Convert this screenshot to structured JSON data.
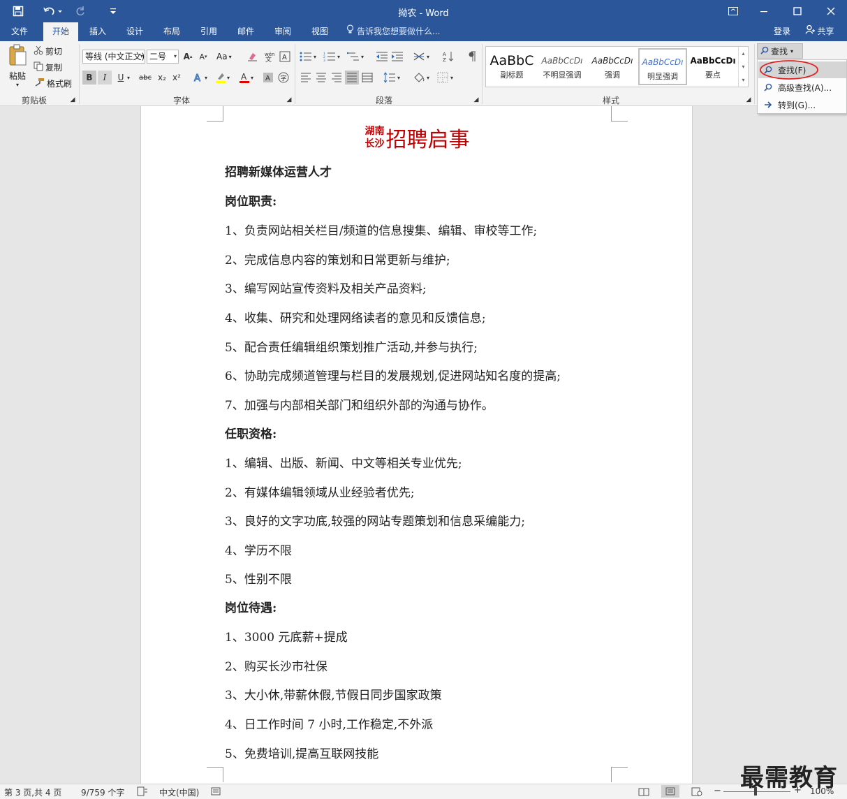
{
  "titlebar": {
    "title": "拗农 - Word"
  },
  "tabs": [
    {
      "label": "文件",
      "active": false
    },
    {
      "label": "开始",
      "active": true
    },
    {
      "label": "插入",
      "active": false
    },
    {
      "label": "设计",
      "active": false
    },
    {
      "label": "布局",
      "active": false
    },
    {
      "label": "引用",
      "active": false
    },
    {
      "label": "邮件",
      "active": false
    },
    {
      "label": "审阅",
      "active": false
    },
    {
      "label": "视图",
      "active": false
    }
  ],
  "tell_me": "告诉我您想要做什么...",
  "account": {
    "login": "登录",
    "share": "共享"
  },
  "clipboard": {
    "paste": "粘贴",
    "cut": "剪切",
    "copy": "复制",
    "format_painter": "格式刷",
    "group": "剪贴板"
  },
  "font": {
    "name": "等线 (中文正文)",
    "size": "二号",
    "aa": "Aa",
    "group": "字体",
    "bold": "B",
    "italic": "I",
    "underline": "U",
    "strike": "abc",
    "sub": "x₂",
    "sup": "x²"
  },
  "paragraph": {
    "group": "段落"
  },
  "styles": {
    "group": "样式",
    "items": [
      {
        "preview": "AaBbC",
        "label": "副标题"
      },
      {
        "preview": "AaBbCcDı",
        "label": "不明显强调"
      },
      {
        "preview": "AaBbCcDı",
        "label": "强调"
      },
      {
        "preview": "AaBbCcDı",
        "label": "明显强调"
      },
      {
        "preview": "AaBbCcDı",
        "label": "要点"
      }
    ]
  },
  "editing": {
    "find": "查找"
  },
  "find_menu": {
    "find": "查找(F)",
    "advanced": "高级查找(A)...",
    "goto": "转到(G)..."
  },
  "document": {
    "title_small_1": "湖南",
    "title_small_2": "长沙",
    "title_main": "招聘启事",
    "paragraphs": [
      {
        "text": "招聘新媒体运营人才",
        "bold": true
      },
      {
        "text": "岗位职责:",
        "bold": true
      },
      {
        "text": "1、负责网站相关栏目/频道的信息搜集、编辑、审校等工作;",
        "bold": false
      },
      {
        "text": "2、完成信息内容的策划和日常更新与维护;",
        "bold": false
      },
      {
        "text": "3、编写网站宣传资料及相关产品资料;",
        "bold": false
      },
      {
        "text": "4、收集、研究和处理网络读者的意见和反馈信息;",
        "bold": false
      },
      {
        "text": "5、配合责任编辑组织策划推广活动,并参与执行;",
        "bold": false
      },
      {
        "text": "6、协助完成频道管理与栏目的发展规划,促进网站知名度的提高;",
        "bold": false
      },
      {
        "text": "7、加强与内部相关部门和组织外部的沟通与协作。",
        "bold": false
      },
      {
        "text": "任职资格:",
        "bold": true
      },
      {
        "text": "1、编辑、出版、新闻、中文等相关专业优先;",
        "bold": false
      },
      {
        "text": "2、有媒体编辑领域从业经验者优先;",
        "bold": false
      },
      {
        "text": "3、良好的文字功底,较强的网站专题策划和信息采编能力;",
        "bold": false
      },
      {
        "text": "4、学历不限",
        "bold": false
      },
      {
        "text": "5、性别不限",
        "bold": false
      },
      {
        "text": "岗位待遇:",
        "bold": true
      },
      {
        "text": "1、3000 元底薪+提成",
        "bold": false
      },
      {
        "text": "2、购买长沙市社保",
        "bold": false
      },
      {
        "text": "3、大小休,带薪休假,节假日同步国家政策",
        "bold": false
      },
      {
        "text": "4、日工作时间 7 小时,工作稳定,不外派",
        "bold": false
      },
      {
        "text": "5、免费培训,提高互联网技能",
        "bold": false
      }
    ]
  },
  "status": {
    "page": "第 3 页,共 4 页",
    "words": "9/759 个字",
    "lang": "中文(中国)",
    "zoom": "100%"
  },
  "watermark": "最需教育",
  "colors": {
    "accent": "#2b579a",
    "title_red": "#c00000",
    "highlight_circle": "#e02020"
  }
}
